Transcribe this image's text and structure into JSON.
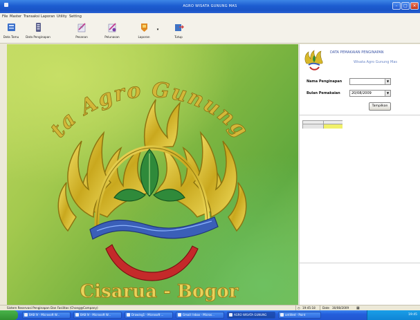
{
  "window": {
    "title": "AGRO WISATA GUNUNG MAS"
  },
  "menubar": {
    "items": [
      "File",
      "Master",
      "Transaksi",
      "Laporan",
      "Utility",
      "Setting"
    ]
  },
  "toolbar": {
    "buttons": [
      {
        "label": "Data Tamu",
        "icon": "guest-icon"
      },
      {
        "label": "Data Penginapan",
        "icon": "lodging-icon"
      },
      {
        "label": "Pesanan",
        "icon": "order-icon"
      },
      {
        "label": "Pelunasan",
        "icon": "payment-icon"
      },
      {
        "label": "Laporan",
        "icon": "report-icon"
      },
      {
        "label": "Tutup",
        "icon": "close-app-icon"
      }
    ]
  },
  "canvas": {
    "arc_text": "Wisata Agro Gunung Mas",
    "bottom_text": "Cisarua - Bogor"
  },
  "panel": {
    "title": "DATA PEMAKAIAN PENGINAPAN",
    "subtitle": "Wisata Agro Gunung Mas",
    "nama_label": "Nama Penginapan",
    "nama_value": "",
    "bulan_label": "Bulan Pemakaian",
    "bulan_value": "20/08/2009",
    "tampilkan_label": "Tampilkan"
  },
  "statusbar": {
    "text": "Sistem Reservasi Penginapan Dan Fasilitas (Chong@Company)",
    "time": "19:45:18",
    "date_label": "Date",
    "date": "30/08/2009"
  },
  "taskbar": {
    "tasks": [
      "BAB IV - Microsoft W...",
      "BAB IV - Microsoft W...",
      "Drawing1 - Microsoft ...",
      "Gmail: Inbox - Micros...",
      "AGRO WISATA GUNUNG",
      "untitled - Paint"
    ],
    "clock": "19:45"
  },
  "colors": {
    "title_bar": "#1c5cd0",
    "panel_title": "#3c55a6",
    "canvas_green": "#7cb541",
    "logo_gold": "#d9c83a",
    "grid_highlight": "#f0f06a"
  }
}
